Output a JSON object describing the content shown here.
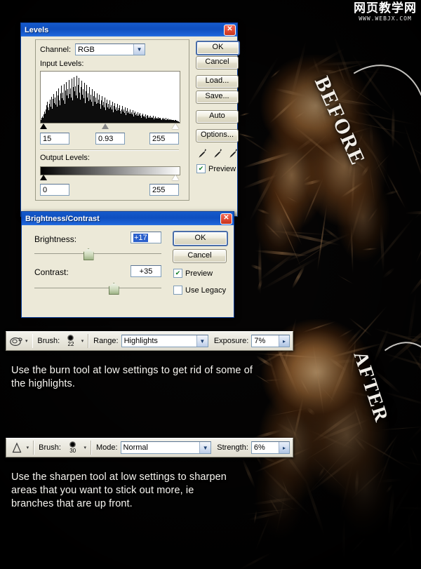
{
  "watermark": {
    "cn": "网页教学网",
    "url": "WWW.WEBJX.COM"
  },
  "annotations": {
    "before_label": "BEFORE",
    "after_label": "AFTER"
  },
  "levels_dialog": {
    "title": "Levels",
    "close_label": "✕",
    "channel_label": "Channel:",
    "channel_value": "RGB",
    "input_levels_label": "Input Levels:",
    "input_black": "15",
    "input_gamma": "0.93",
    "input_white": "255",
    "output_levels_label": "Output Levels:",
    "output_black": "0",
    "output_white": "255",
    "buttons": [
      "OK",
      "Cancel",
      "Load...",
      "Save...",
      "Auto",
      "Options..."
    ],
    "preview_label": "Preview",
    "preview_checked": "✔",
    "eyedropper_icons": [
      "eyedropper-black",
      "eyedropper-gray",
      "eyedropper-white"
    ],
    "histogram": [
      6,
      9,
      7,
      12,
      10,
      16,
      13,
      22,
      18,
      26,
      21,
      33,
      28,
      41,
      30,
      24,
      36,
      29,
      44,
      31,
      50,
      36,
      27,
      46,
      33,
      55,
      38,
      29,
      48,
      35,
      60,
      41,
      31,
      52,
      38,
      66,
      43,
      33,
      56,
      40,
      71,
      47,
      35,
      58,
      43,
      74,
      49,
      37,
      62,
      45,
      78,
      52,
      39,
      64,
      47,
      82,
      55,
      41,
      66,
      49,
      85,
      57,
      43,
      68,
      51,
      88,
      60,
      45,
      70,
      53,
      90,
      62,
      47,
      72,
      55,
      86,
      58,
      44,
      68,
      50,
      80,
      54,
      41,
      64,
      47,
      76,
      51,
      38,
      60,
      44,
      72,
      48,
      36,
      57,
      42,
      68,
      45,
      34,
      54,
      40,
      64,
      43,
      32,
      51,
      38,
      60,
      40,
      30,
      48,
      36,
      57,
      38,
      28,
      45,
      34,
      54,
      36,
      27,
      43,
      32,
      51,
      34,
      25,
      41,
      30,
      48,
      32,
      24,
      38,
      29,
      45,
      30,
      22,
      36,
      27,
      43,
      29,
      21,
      34,
      26,
      41,
      27,
      20,
      32,
      24,
      38,
      26,
      19,
      30,
      23,
      36,
      24,
      18,
      28,
      21,
      34,
      23,
      17,
      26,
      20,
      32,
      21,
      16,
      25,
      19,
      30,
      20,
      15,
      23,
      18,
      28,
      19,
      14,
      22,
      17,
      26,
      18,
      13,
      20,
      16,
      24,
      17,
      12,
      19,
      15,
      22,
      15,
      11,
      17,
      14,
      20,
      14,
      10,
      16,
      13,
      19,
      13,
      10,
      15,
      12,
      18,
      12,
      9,
      14,
      11,
      16,
      11,
      8,
      13,
      10,
      15,
      10,
      8,
      12,
      10,
      14,
      10,
      7,
      11,
      9,
      13,
      9,
      7,
      10,
      8,
      12,
      8,
      6,
      10,
      8,
      11,
      8,
      6,
      9,
      7,
      10,
      7,
      5,
      8,
      7,
      9,
      7,
      5,
      8,
      6,
      9,
      6,
      5,
      7,
      6,
      8,
      6,
      4,
      7,
      5,
      7,
      5,
      4,
      6,
      5,
      6,
      5,
      4,
      5,
      4,
      5,
      4,
      3,
      4,
      3,
      3,
      2,
      2
    ]
  },
  "brightness_dialog": {
    "title": "Brightness/Contrast",
    "close_label": "✕",
    "brightness_label": "Brightness:",
    "brightness_value": "+17",
    "brightness_slider_pct": 42,
    "contrast_label": "Contrast:",
    "contrast_value": "+35",
    "contrast_slider_pct": 62,
    "buttons": [
      "OK",
      "Cancel"
    ],
    "preview_label": "Preview",
    "preview_checked": "✔",
    "use_legacy_label": "Use Legacy",
    "use_legacy_checked": ""
  },
  "burn_toolbar": {
    "tool_icon": "burn-tool-icon",
    "tool_dropdown": "▾",
    "brush_label": "Brush:",
    "brush_size": "22",
    "brush_dropdown": "▾",
    "range_label": "Range:",
    "range_value": "Highlights",
    "exposure_label": "Exposure:",
    "exposure_value": "7%",
    "exposure_arrow": "▸"
  },
  "sharpen_toolbar": {
    "tool_icon": "sharpen-tool-icon",
    "tool_dropdown": "▾",
    "brush_label": "Brush:",
    "brush_size": "30",
    "brush_dropdown": "▾",
    "mode_label": "Mode:",
    "mode_value": "Normal",
    "strength_label": "Strength:",
    "strength_value": "6%",
    "strength_arrow": "▸"
  },
  "captions": {
    "burn_text": "Use the burn tool at low settings to get rid of some of the highlights.",
    "sharpen_text": "Use the sharpen tool at low settings to sharpen areas that you want to stick out more, ie branches that are up front."
  },
  "colors": {
    "title_blue": "#0f4fc0",
    "dialog_face": "#ece9d8",
    "close_red": "#e24a33",
    "select_blue": "#bccde8"
  }
}
